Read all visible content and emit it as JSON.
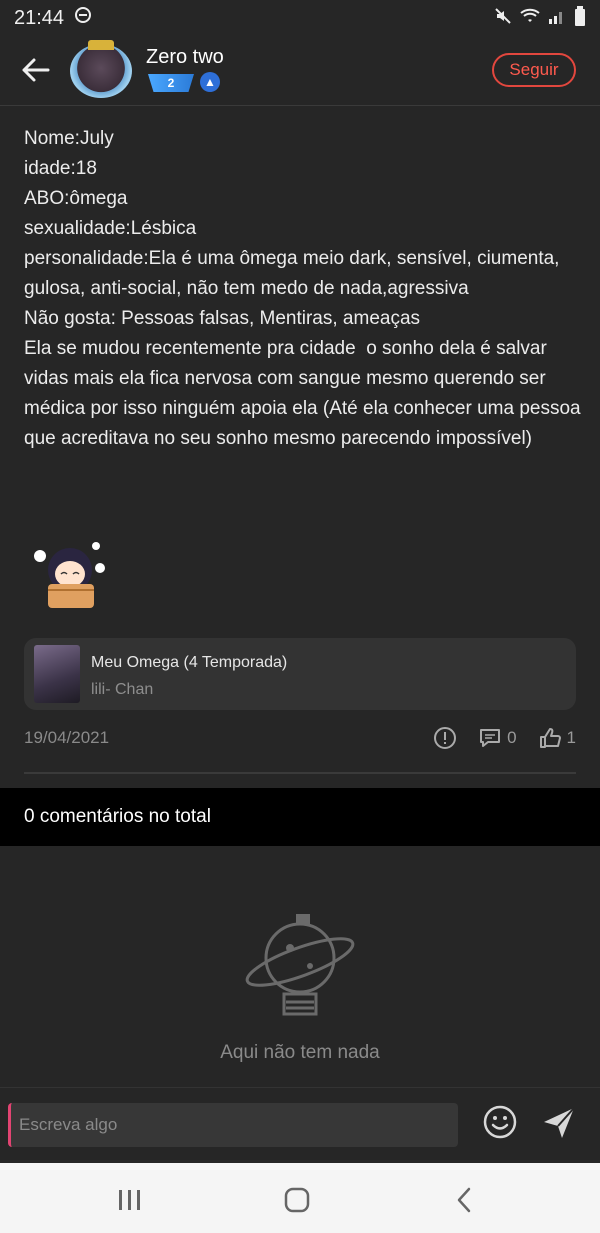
{
  "status_bar": {
    "time": "21:44",
    "dnd_icon": "do-not-disturb-icon",
    "mute_icon": "mute-icon",
    "wifi_icon": "wifi-icon",
    "signal_icon": "signal-icon",
    "battery_icon": "battery-icon"
  },
  "header": {
    "back_icon": "back-arrow-icon",
    "username": "Zero two",
    "level": "2",
    "role_icon": "member-badge-icon",
    "follow_label": "Seguir"
  },
  "post": {
    "text": "Nome:July\nidade:18\nABO:ômega\nsexualidade:Lésbica\npersonalidade:Ela é uma ômega meio dark, sensível, ciumenta, gulosa, anti-social, não tem medo de nada,agressiva\nNão gosta: Pessoas falsas, Mentiras, ameaças\nEla se mudou recentemente pra cidade  o sonho dela é salvar vidas mais ela fica nervosa com sangue mesmo querendo ser médica por isso ninguém apoia ela (Até ela conhecer uma pessoa que acreditava no seu sonho mesmo parecendo impossível)",
    "linked": {
      "title": "Meu Omega (4 Temporada)",
      "author": "lili- Chan"
    },
    "date": "19/04/2021",
    "comment_count": "0",
    "like_count": "1"
  },
  "comments": {
    "header": "0 comentários no total",
    "empty_text": "Aqui não tem nada"
  },
  "composer": {
    "placeholder": "Escreva algo"
  },
  "colors": {
    "background": "#262626",
    "accent_red": "#e2473e",
    "badge_blue": "#2b7bd8"
  }
}
